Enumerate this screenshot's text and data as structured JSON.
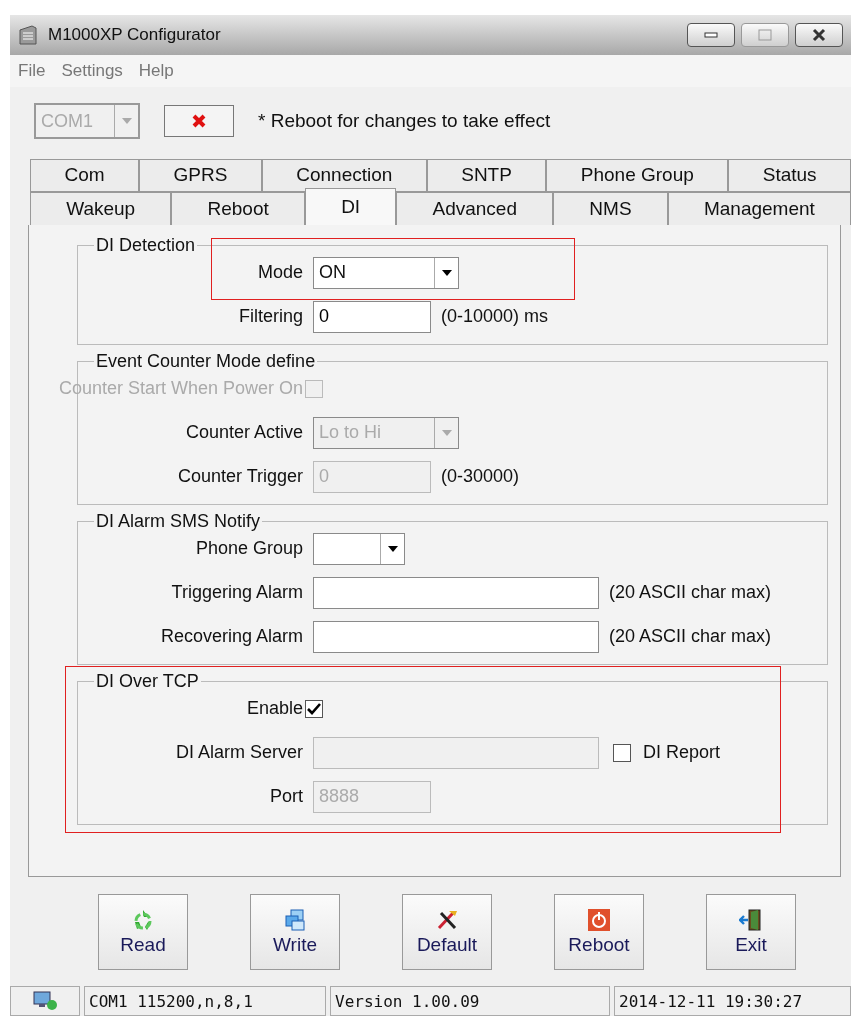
{
  "window": {
    "title": "M1000XP Configurator"
  },
  "menu": [
    "File",
    "Settings",
    "Help"
  ],
  "toolbar": {
    "port": {
      "value": "COM1",
      "disabled": true
    },
    "note": "* Reboot for changes to take effect"
  },
  "tabs": [
    [
      {
        "label": "Com",
        "selected": false
      },
      {
        "label": "GPRS",
        "selected": false
      },
      {
        "label": "Connection",
        "selected": false
      },
      {
        "label": "SNTP",
        "selected": false
      },
      {
        "label": "Phone Group",
        "selected": false
      },
      {
        "label": "Status",
        "selected": false
      }
    ],
    [
      {
        "label": "Wakeup",
        "selected": false
      },
      {
        "label": "Reboot",
        "selected": false
      },
      {
        "label": "DI",
        "selected": true
      },
      {
        "label": "Advanced",
        "selected": false
      },
      {
        "label": "NMS",
        "selected": false
      },
      {
        "label": "Management",
        "selected": false
      }
    ]
  ],
  "groups": [
    {
      "title": "DI Detection",
      "highlighted": false,
      "rows": [
        {
          "kind": "combo",
          "label": "Mode",
          "value": "ON",
          "disabled": false,
          "highlighted": true
        },
        {
          "kind": "text",
          "label": "Filtering",
          "value": "0",
          "hint": "(0-10000) ms",
          "disabled": false,
          "highlighted": false
        }
      ]
    },
    {
      "title": "Event Counter Mode define",
      "highlighted": false,
      "rows": [
        {
          "kind": "checkbox",
          "label": "Counter Start When Power On",
          "checked": false,
          "disabled": true,
          "highlighted": false
        },
        {
          "kind": "combo",
          "label": "Counter Active",
          "value": "Lo to Hi",
          "disabled": true,
          "highlighted": false
        },
        {
          "kind": "text",
          "label": "Counter Trigger",
          "value": "0",
          "hint": "(0-30000)",
          "disabled": true,
          "highlighted": false
        }
      ]
    },
    {
      "title": "DI Alarm SMS Notify",
      "highlighted": false,
      "rows": [
        {
          "kind": "combo",
          "label": "Phone Group",
          "disabled": false,
          "highlighted": false
        },
        {
          "kind": "longtext",
          "label": "Triggering Alarm",
          "hint": "(20 ASCII char max)",
          "disabled": false,
          "highlighted": false
        },
        {
          "kind": "longtext",
          "label": "Recovering Alarm",
          "hint": "(20 ASCII char max)",
          "disabled": false,
          "highlighted": false
        }
      ]
    },
    {
      "title": "DI Over TCP",
      "highlighted": true,
      "rows": [
        {
          "kind": "checkbox",
          "label": "Enable",
          "checked": true,
          "disabled": false,
          "highlighted": false
        },
        {
          "kind": "longtext",
          "label": "DI Alarm Server",
          "disabled": true,
          "highlighted": false,
          "side": {
            "label": "DI Report",
            "checked": false
          }
        },
        {
          "kind": "text",
          "label": "Port",
          "value": "8888",
          "disabled": true,
          "highlighted": false
        }
      ]
    }
  ],
  "buttons": [
    {
      "kind": "read",
      "label": "Read"
    },
    {
      "kind": "write",
      "label": "Write"
    },
    {
      "kind": "default",
      "label": "Default"
    },
    {
      "kind": "reboot",
      "label": "Reboot"
    },
    {
      "kind": "exit",
      "label": "Exit"
    }
  ],
  "status_bar": [
    "COM1 115200,n,8,1",
    "Version 1.00.09",
    "2014-12-11 19:30:27"
  ]
}
